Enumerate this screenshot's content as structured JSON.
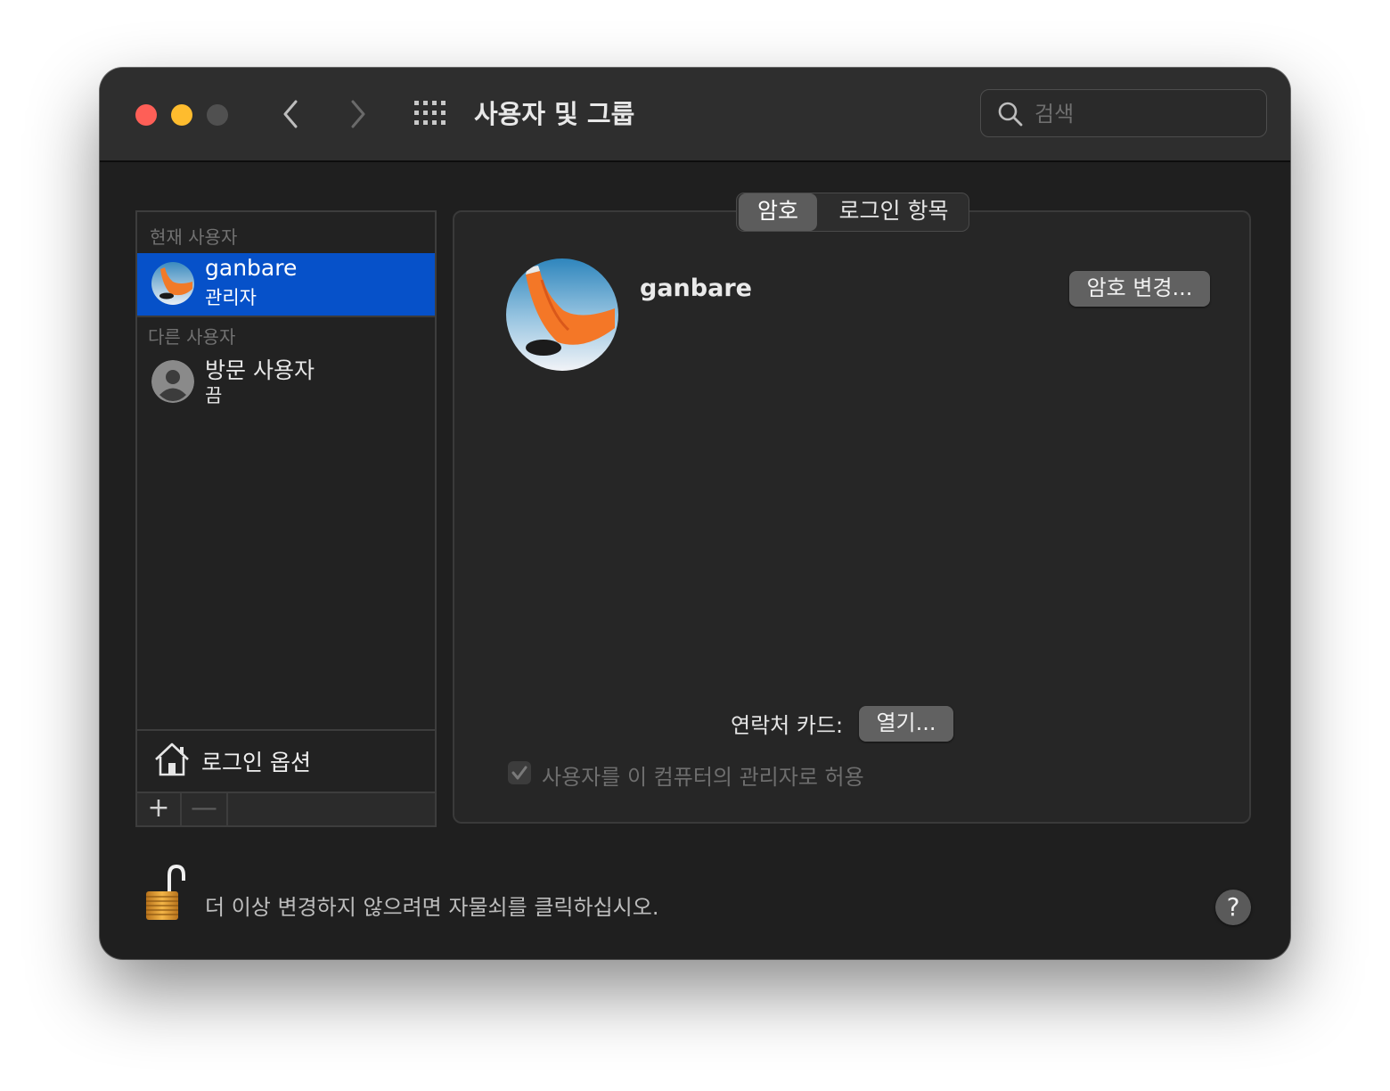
{
  "window": {
    "title": "사용자 및 그룹",
    "search_placeholder": "검색"
  },
  "sidebar": {
    "current_header": "현재 사용자",
    "current_user": {
      "name": "ganbare",
      "role": "관리자"
    },
    "other_header": "다른 사용자",
    "other_user": {
      "name": "방문 사용자",
      "status": "끔"
    },
    "login_options": "로그인 옵션",
    "add_button": "+",
    "remove_button": "—"
  },
  "tabs": [
    {
      "label": "암호",
      "active": true
    },
    {
      "label": "로그인 항목",
      "active": false
    }
  ],
  "profile": {
    "name": "ganbare",
    "change_password_button": "암호 변경...",
    "contact_card_label": "연락처 카드:",
    "open_button": "열기...",
    "admin_checkbox_label": "사용자를 이 컴퓨터의 관리자로 허용",
    "admin_checkbox_checked": true
  },
  "footer": {
    "lock_text": "더 이상 변경하지 않으려면 자물쇠를 클릭하십시오.",
    "help_button": "?"
  },
  "colors": {
    "selection": "#0651c9",
    "window_bg": "#1f1f1f",
    "close": "#fe5f57",
    "minimize": "#febc2e"
  },
  "icons": [
    "back-icon",
    "forward-icon",
    "grid-icon",
    "search-icon",
    "user-silhouette-icon",
    "house-icon",
    "padlock-open-icon",
    "help-icon"
  ]
}
